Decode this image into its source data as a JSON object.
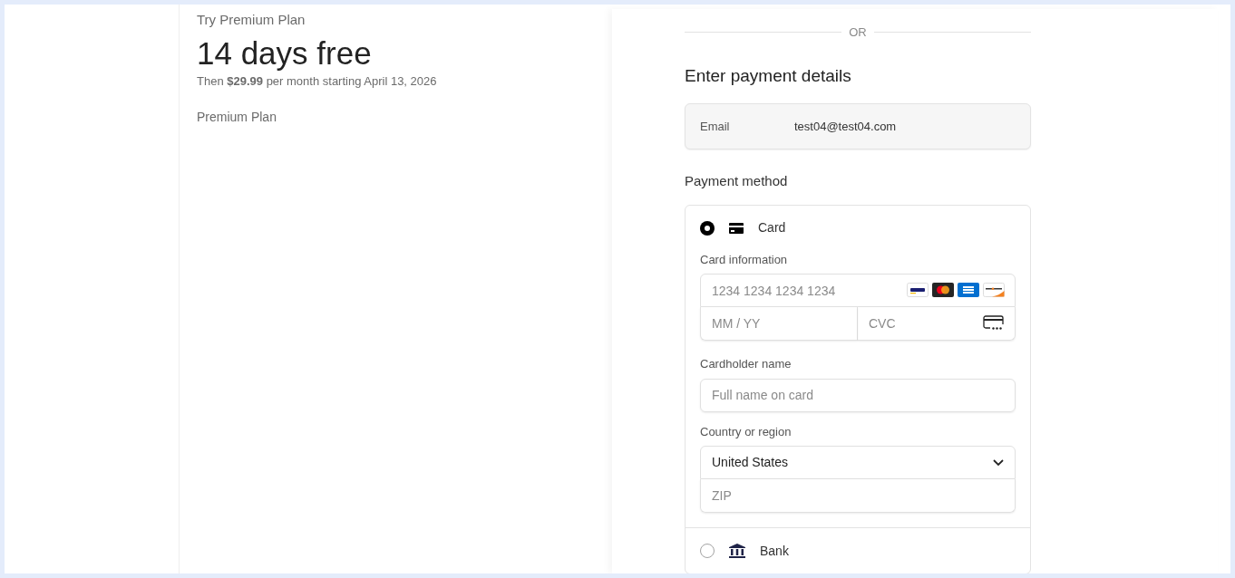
{
  "summary": {
    "eyebrow": "Try Premium Plan",
    "headline": "14 days free",
    "subtext": "Then **$29.99** per month starting April 13, 2026",
    "plan_name": "Premium Plan"
  },
  "divider_label": "OR",
  "payment": {
    "title": "Enter payment details",
    "email": {
      "label": "Email",
      "value": "test04@test04.com"
    },
    "method_title": "Payment method",
    "methods": [
      {
        "kind": "card",
        "label": "Card",
        "selected": true
      },
      {
        "kind": "bank",
        "label": "Bank",
        "selected": false
      }
    ],
    "card": {
      "info_label": "Card information",
      "number_placeholder": "1234 1234 1234 1234",
      "expiry_placeholder": "MM / YY",
      "cvc_placeholder": "CVC",
      "name_label": "Cardholder name",
      "name_placeholder": "Full name on card",
      "country_label": "Country or region",
      "country_value": "United States",
      "zip_placeholder": "ZIP"
    }
  }
}
